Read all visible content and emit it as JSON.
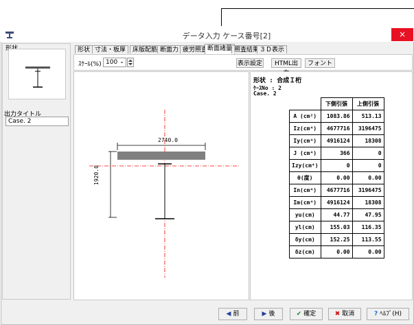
{
  "window": {
    "title": "データ入力 ケース番号[2]",
    "close_glyph": "×"
  },
  "left": {
    "shape_label": "形状",
    "output_title_label": "出力タイトル",
    "output_title_value": "Case. 2"
  },
  "tabs": [
    "形状",
    "寸法・板厚",
    "床版配筋",
    "断面力",
    "疲労照査",
    "断面諸量",
    "照査結果",
    "３Ｄ表示"
  ],
  "active_tab": "断面諸量",
  "toolbar": {
    "scale_label": "ｽｹｰﾙ(%)",
    "scale_value": "100",
    "display_settings": "表示設定",
    "html_output": "HTML出力",
    "font": "フォント"
  },
  "drawing": {
    "width_dim": "2740.0",
    "height_dim": "1920.0"
  },
  "results": {
    "shape_line": "形状 : 合成Ｉ桁",
    "case_no_line": "ｹｰｽNo : 2",
    "case_name_line": "Case. 2",
    "headers": [
      "",
      "下側引張",
      "上側引張"
    ],
    "rows": [
      [
        "A (cm²)",
        "1083.86",
        "513.13"
      ],
      [
        "Iz(cm⁴)",
        "4677716",
        "3196475"
      ],
      [
        "Iy(cm⁴)",
        "4916124",
        "18308"
      ],
      [
        "J (cm⁴)",
        "366",
        "0"
      ],
      [
        "Izy(cm⁴)",
        "0",
        "0"
      ],
      [
        "θ(度)",
        "0.00",
        "0.00"
      ],
      [
        "In(cm⁴)",
        "4677716",
        "3196475"
      ],
      [
        "Im(cm⁴)",
        "4916124",
        "18308"
      ],
      [
        "yu(cm)",
        "44.77",
        "47.95"
      ],
      [
        "yl(cm)",
        "155.03",
        "116.35"
      ],
      [
        "δy(cm)",
        "152.25",
        "113.55"
      ],
      [
        "δz(cm)",
        "0.00",
        "0.00"
      ]
    ]
  },
  "bottom": {
    "prev": "前",
    "next": "後",
    "ok": "確定",
    "cancel": "取消",
    "help": "ﾍﾙﾌﾟ(H)"
  },
  "colors": {
    "close": "#e81123",
    "section_fill": "#808080",
    "center_line": "#ff0000"
  }
}
